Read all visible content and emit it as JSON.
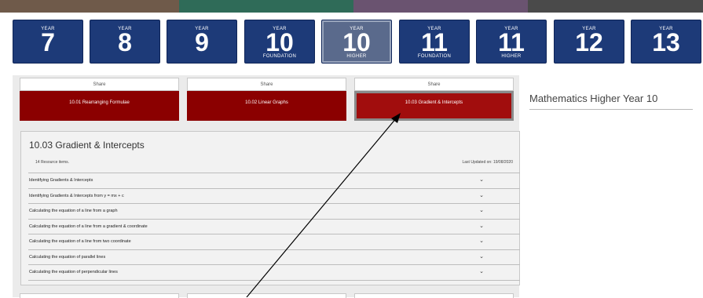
{
  "banner": {
    "colors": [
      "#6f5a4a",
      "#2f6b58",
      "#6a5370",
      "#4a4a4a"
    ]
  },
  "years": [
    {
      "prefix": "YEAR",
      "number": "7",
      "sub": ""
    },
    {
      "prefix": "YEAR",
      "number": "8",
      "sub": ""
    },
    {
      "prefix": "YEAR",
      "number": "9",
      "sub": ""
    },
    {
      "prefix": "YEAR",
      "number": "10",
      "sub": "FOUNDATION"
    },
    {
      "prefix": "YEAR",
      "number": "10",
      "sub": "HIGHER"
    },
    {
      "prefix": "YEAR",
      "number": "11",
      "sub": "FOUNDATION"
    },
    {
      "prefix": "YEAR",
      "number": "11",
      "sub": "HIGHER"
    },
    {
      "prefix": "YEAR",
      "number": "12",
      "sub": ""
    },
    {
      "prefix": "YEAR",
      "number": "13",
      "sub": ""
    }
  ],
  "topics": [
    {
      "share": "Share",
      "label": "10.01 Rearranging Formulae"
    },
    {
      "share": "Share",
      "label": "10.02 Linear Graphs"
    },
    {
      "share": "Share",
      "label": "10.03 Gradient & Intercepts"
    }
  ],
  "panel": {
    "title": "10.03 Gradient & Intercepts",
    "count": "14 Resource items.",
    "updated": "Last Updated on: 19/08/2020",
    "items": [
      "Identifying Gradients & Intercepts",
      "Identifying Gradients & Intercepts from y = mx + c",
      "Calculating the equation of a line from a graph",
      "Calculating the equation of a line from a gradient & coordinate",
      "Calculating the equation of a line from two coordinate",
      "Calculating the equation of parallel lines",
      "Calculating the equation of perpendicular lines"
    ]
  },
  "sidebar": {
    "title": "Mathematics Higher Year 10"
  },
  "colors": {
    "tile": "#1d3a78",
    "topic": "#8b0000",
    "accent": "#a10d0d"
  }
}
